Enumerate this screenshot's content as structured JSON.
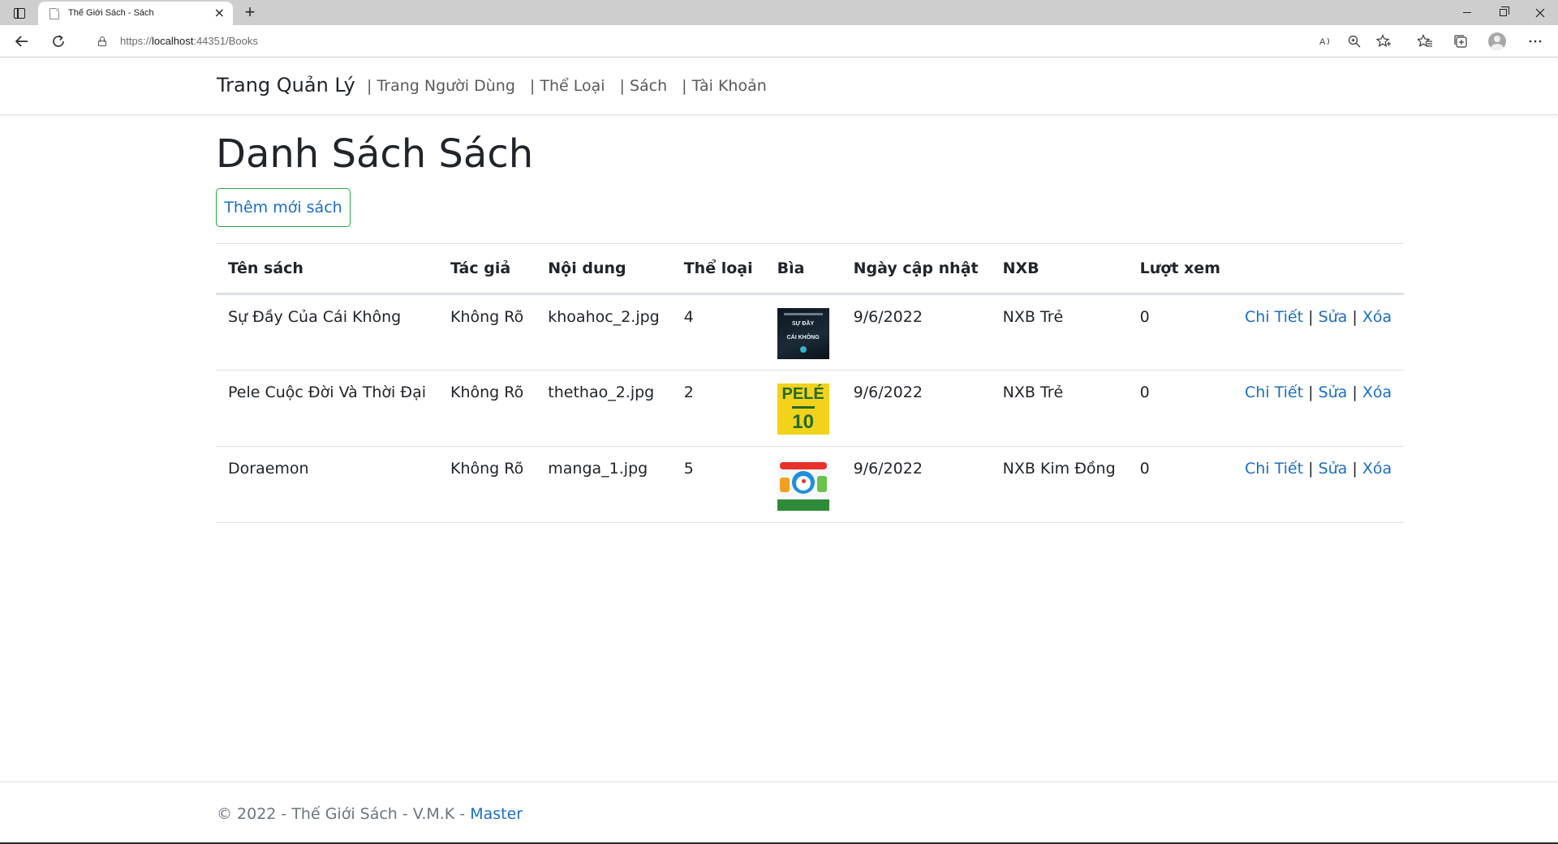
{
  "browser": {
    "tab_title": "Thế Giới Sách - Sách",
    "url_scheme": "https://",
    "url_host": "localhost",
    "url_rest": ":44351/Books",
    "new_tab_glyph": "+",
    "close_glyph": "×"
  },
  "nav": {
    "brand": "Trang Quản Lý",
    "links": [
      "| Trang Người Dùng",
      "| Thể Loại",
      "| Sách",
      "| Tài Khoản"
    ]
  },
  "page": {
    "title": "Danh Sách Sách",
    "add_button": "Thêm mới sách"
  },
  "table": {
    "headers": [
      "Tên sách",
      "Tác giả",
      "Nội dung",
      "Thể loại",
      "Bìa",
      "Ngày cập nhật",
      "NXB",
      "Lượt xem"
    ],
    "rows": [
      {
        "name": "Sự Đầy Của Cái Không",
        "author": "Không Rõ",
        "content": "khoahoc_2.jpg",
        "genre": "4",
        "cover_text_1": "SỰ ĐẦY",
        "cover_text_2": "CÁI KHÔNG",
        "date": "9/6/2022",
        "publisher": "NXB Trẻ",
        "views": "0"
      },
      {
        "name": "Pele Cuộc Đời Và Thời Đại",
        "author": "Không Rõ",
        "content": "thethao_2.jpg",
        "genre": "2",
        "cover_text_1": "PELÉ",
        "cover_text_2": "10",
        "date": "9/6/2022",
        "publisher": "NXB Trẻ",
        "views": "0"
      },
      {
        "name": "Doraemon",
        "author": "Không Rõ",
        "content": "manga_1.jpg",
        "genre": "5",
        "date": "9/6/2022",
        "publisher": "NXB Kim Đồng",
        "views": "0"
      }
    ],
    "actions": {
      "details": "Chi Tiết",
      "edit": "Sửa",
      "delete": "Xóa",
      "separator": "|"
    }
  },
  "footer": {
    "text": "© 2022 - Thế Giới Sách - V.M.K - ",
    "link": "Master"
  },
  "colors": {
    "link": "#1b6ec2",
    "add_button_border": "#28a745",
    "text": "#212529",
    "muted": "#6c757d"
  }
}
